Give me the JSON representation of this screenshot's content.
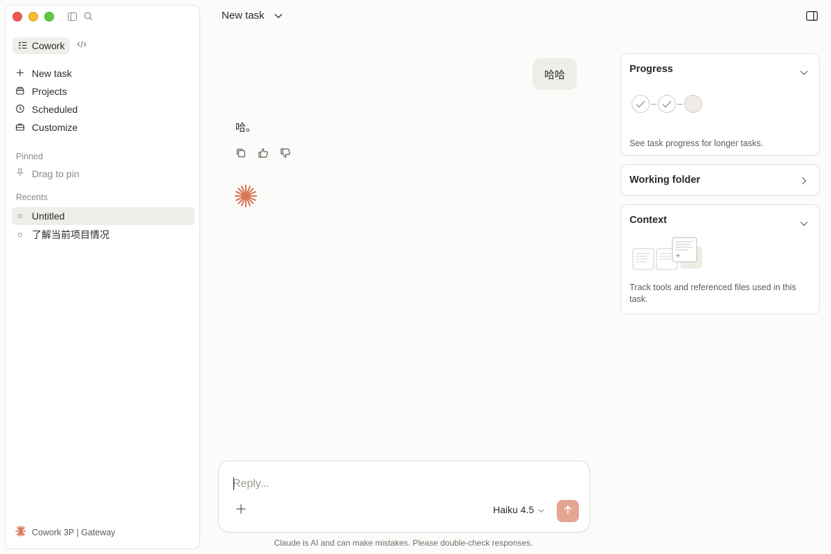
{
  "header": {
    "title": "New task"
  },
  "sidebar": {
    "mode_label": "Cowork",
    "nav": [
      {
        "label": "New task",
        "icon": "plus-icon"
      },
      {
        "label": "Projects",
        "icon": "folder-icon"
      },
      {
        "label": "Scheduled",
        "icon": "clock-icon"
      },
      {
        "label": "Customize",
        "icon": "briefcase-icon"
      }
    ],
    "pinned_label": "Pinned",
    "pin_hint": "Drag to pin",
    "recents_label": "Recents",
    "recents": [
      {
        "label": "Untitled",
        "active": true
      },
      {
        "label": "了解当前项目情况",
        "active": false
      }
    ],
    "footer": "Cowork 3P | Gateway"
  },
  "chat": {
    "user_message": "哈哈",
    "assistant_message": "哈。"
  },
  "composer": {
    "placeholder": "Reply...",
    "model": "Haiku 4.5"
  },
  "disclaimer": "Claude is AI and can make mistakes. Please double-check responses.",
  "panels": {
    "progress": {
      "title": "Progress",
      "note": "See task progress for longer tasks."
    },
    "working_folder": {
      "title": "Working folder"
    },
    "context": {
      "title": "Context",
      "note": "Track tools and referenced files used in this task."
    }
  },
  "colors": {
    "accent": "#d97757",
    "send_button": "#e4a592"
  }
}
